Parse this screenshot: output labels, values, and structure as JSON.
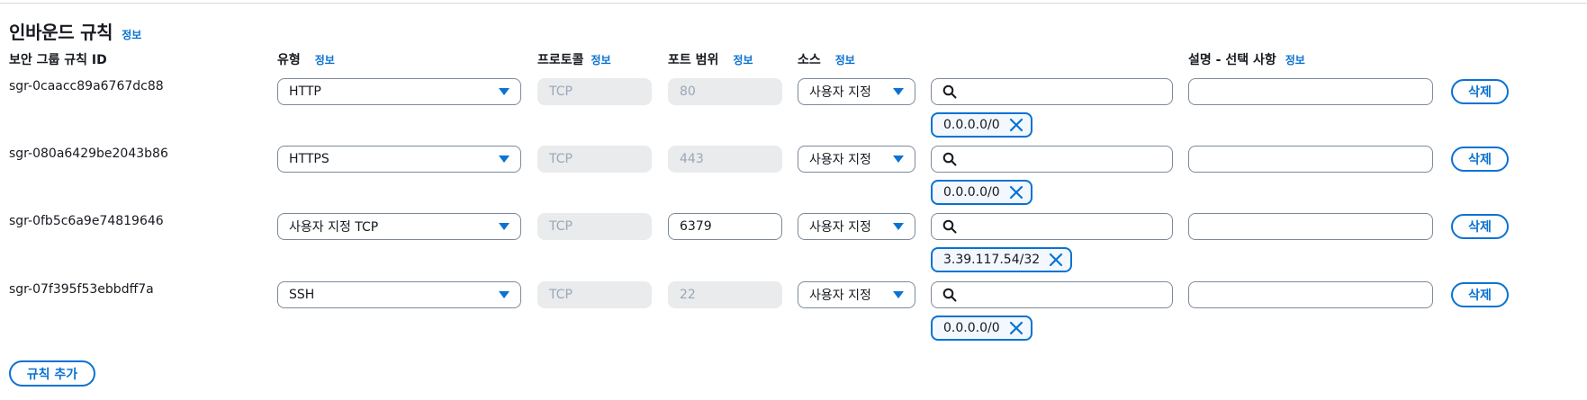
{
  "section": {
    "title": "인바운드 규칙",
    "info": "정보"
  },
  "columns": {
    "id": "보안 그룹 규칙 ID",
    "type": "유형",
    "protocol": "프로토콜",
    "port": "포트 범위",
    "source": "소스",
    "description": "설명 - 선택 사항",
    "info": "정보"
  },
  "rules": [
    {
      "id": "sgr-0caacc89a6767dc88",
      "type": "HTTP",
      "protocol": "TCP",
      "port": "80",
      "port_editable": false,
      "source": "사용자 지정",
      "search": "",
      "cidr": "0.0.0.0/0",
      "description": "",
      "delete": "삭제"
    },
    {
      "id": "sgr-080a6429be2043b86",
      "type": "HTTPS",
      "protocol": "TCP",
      "port": "443",
      "port_editable": false,
      "source": "사용자 지정",
      "search": "",
      "cidr": "0.0.0.0/0",
      "description": "",
      "delete": "삭제"
    },
    {
      "id": "sgr-0fb5c6a9e74819646",
      "type": "사용자 지정 TCP",
      "protocol": "TCP",
      "port": "6379",
      "port_editable": true,
      "source": "사용자 지정",
      "search": "",
      "cidr": "3.39.117.54/32",
      "description": "",
      "delete": "삭제"
    },
    {
      "id": "sgr-07f395f53ebbdff7a",
      "type": "SSH",
      "protocol": "TCP",
      "port": "22",
      "port_editable": false,
      "source": "사용자 지정",
      "search": "",
      "cidr": "0.0.0.0/0",
      "description": "",
      "delete": "삭제"
    }
  ],
  "add_rule": "규칙 추가",
  "colors": {
    "accent": "#0972d3",
    "text": "#16191f",
    "disabled_bg": "#e9ebed",
    "disabled_text": "#9ba7b6",
    "border": "#7d8998",
    "token_bg": "#f2f8fd"
  },
  "icons": {
    "search": "search-icon",
    "remove": "close-icon",
    "dropdown": "caret-down-icon"
  }
}
